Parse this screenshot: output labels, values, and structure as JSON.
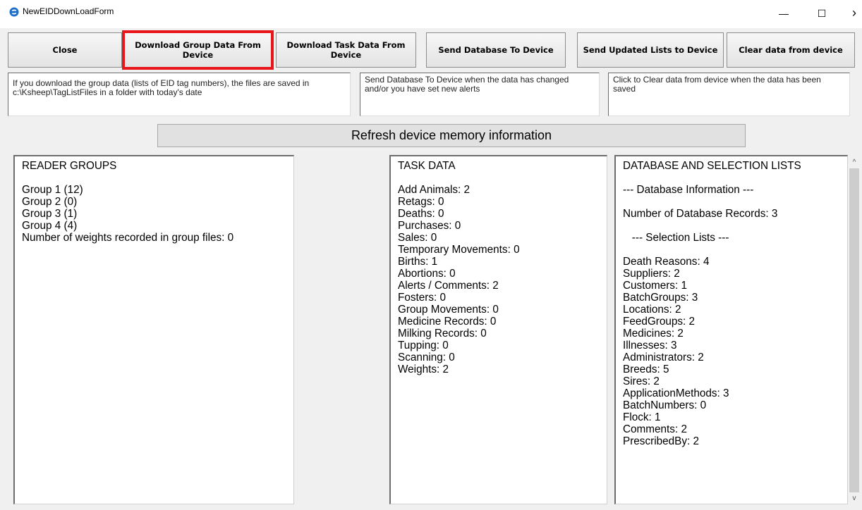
{
  "window": {
    "title": "NewEIDDownLoadForm",
    "minimize_glyph": "—",
    "maximize_glyph": "☐",
    "close_glyph": "›"
  },
  "toolbar": {
    "close_label": "Close",
    "download_group_label": "Download Group Data From Device",
    "download_task_label": "Download Task Data From Device",
    "send_database_label": "Send Database To Device",
    "send_lists_label": "Send Updated Lists to Device",
    "clear_data_label": "Clear data from device"
  },
  "info": {
    "group_text": "If you download the group data (lists of EID tag numbers), the files are saved in c:\\Ksheep\\TagListFiles in a folder with today's date",
    "database_text": "Send Database To Device when the data  has changed and/or you have set new alerts",
    "clear_text": "Click to Clear data from device when the data has been saved"
  },
  "refresh_label": "Refresh device memory information",
  "reader_groups": {
    "heading": "READER GROUPS",
    "lines": [
      "Group 1 (12)",
      "Group 2 (0)",
      "Group 3 (1)",
      "Group 4 (4)",
      "Number of weights recorded in group files: 0"
    ]
  },
  "task_data": {
    "heading": "TASK DATA",
    "lines": [
      "Add Animals: 2",
      "Retags: 0",
      "Deaths: 0",
      "Purchases: 0",
      "Sales: 0",
      "Temporary Movements: 0",
      "Births: 1",
      "Abortions: 0",
      "Alerts / Comments: 2",
      "Fosters: 0",
      "Group Movements: 0",
      "Medicine Records: 0",
      "Milking Records: 0",
      "Tupping: 0",
      "Scanning: 0",
      "Weights: 2"
    ]
  },
  "database_lists": {
    "heading": "DATABASE AND SELECTION LISTS",
    "db_info_header": "--- Database Information ---",
    "db_records": "Number of Database Records: 3",
    "selection_header": "   --- Selection Lists ---",
    "lines": [
      "Death Reasons: 4",
      "Suppliers: 2",
      "Customers: 1",
      "BatchGroups: 3",
      "Locations: 2",
      "FeedGroups: 2",
      "Medicines: 2",
      "Illnesses: 3",
      "Administrators: 2",
      "Breeds: 5",
      "Sires: 2",
      "ApplicationMethods: 3",
      "BatchNumbers: 0",
      "Flock: 1",
      "Comments: 2",
      "PrescribedBy: 2"
    ]
  },
  "scrollbar": {
    "up_glyph": "^",
    "down_glyph": "v"
  },
  "colors": {
    "highlight": "#e8161b",
    "panel_bg": "#ffffff",
    "window_bg": "#f0f0f0",
    "icon_primary": "#1e6fc9"
  }
}
